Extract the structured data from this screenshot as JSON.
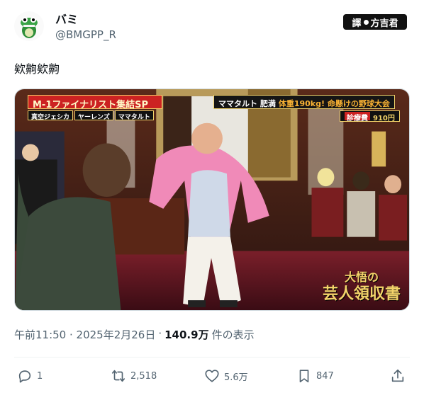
{
  "author": {
    "display_name": "バミ",
    "handle": "@BMGPP_R"
  },
  "watermark": {
    "left": "譯",
    "right": "方吉君"
  },
  "tweet": {
    "text": "欸齁欸齁"
  },
  "media_captions": {
    "title": "M-1ファイナリスト集結SP",
    "names": [
      "真空ジェシカ",
      "ヤーレンズ",
      "ママタルト"
    ],
    "event_prefix": "ママタルト 肥満",
    "event_main": "体重190kg! 命懸けの野球大会",
    "fee_label": "診療費",
    "fee_value": "910円",
    "logo_line1": "大悟の",
    "logo_line2": "芸人領収書"
  },
  "meta": {
    "timestamp": "午前11:50 · 2025年2月26日",
    "separator": "·",
    "views_count": "140.9万",
    "views_label": "件の表示"
  },
  "actions": {
    "replies": "1",
    "retweets": "2,518",
    "likes": "5.6万",
    "bookmarks": "847"
  }
}
